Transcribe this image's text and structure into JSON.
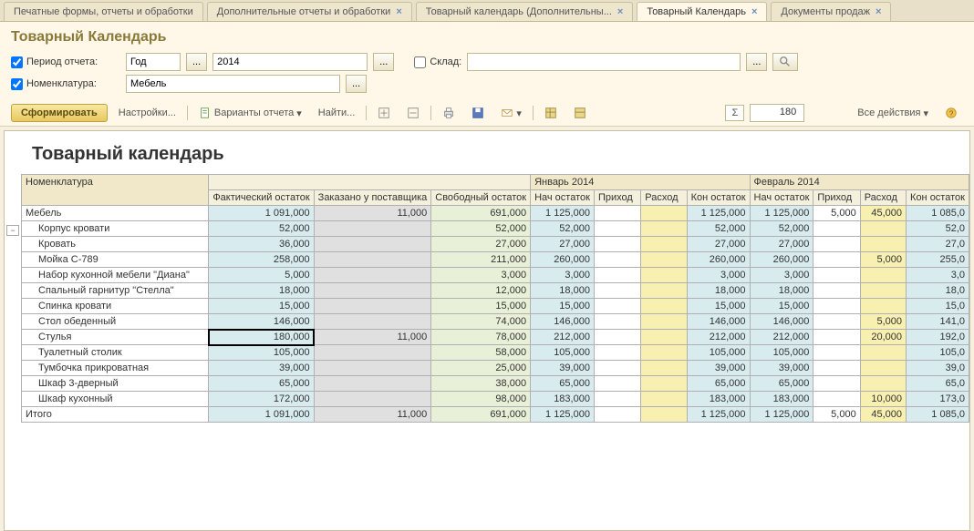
{
  "tabs": [
    {
      "label": "Печатные формы, отчеты и обработки",
      "closable": false,
      "active": false
    },
    {
      "label": "Дополнительные отчеты и обработки",
      "closable": true,
      "active": false
    },
    {
      "label": "Товарный календарь (Дополнительны...",
      "closable": true,
      "active": false
    },
    {
      "label": "Товарный Календарь",
      "closable": true,
      "active": true
    },
    {
      "label": "Документы продаж",
      "closable": true,
      "active": false
    }
  ],
  "page_title": "Товарный Календарь",
  "filters": {
    "period_label": "Период отчета:",
    "period_checked": true,
    "period_type": "Год",
    "period_value": "2014",
    "sklad_label": "Склад:",
    "sklad_checked": false,
    "sklad_value": "",
    "nomen_label": "Номенклатура:",
    "nomen_checked": true,
    "nomen_value": "Мебель"
  },
  "toolbar": {
    "form": "Сформировать",
    "settings": "Настройки...",
    "variants": "Варианты отчета",
    "find": "Найти...",
    "sum_value": "180",
    "all_actions": "Все действия"
  },
  "report": {
    "title": "Товарный календарь",
    "col_nomen": "Номенклатура",
    "month1": "Январь 2014",
    "month2": "Февраль 2014",
    "cols_main": [
      "Фактический остаток",
      "Заказано у поставщика",
      "Свободный остаток"
    ],
    "cols_month": [
      "Нач остаток",
      "Приход",
      "Расход",
      "Кон остаток"
    ],
    "group_row": {
      "name": "Мебель",
      "vals": [
        "1 091,000",
        "11,000",
        "691,000",
        "1 125,000",
        "",
        "",
        "1 125,000",
        "1 125,000",
        "5,000",
        "45,000",
        "1 085,0"
      ]
    },
    "rows": [
      {
        "name": "Корпус кровати",
        "vals": [
          "52,000",
          "",
          "52,000",
          "52,000",
          "",
          "",
          "52,000",
          "52,000",
          "",
          "",
          "52,0"
        ]
      },
      {
        "name": "Кровать",
        "vals": [
          "36,000",
          "",
          "27,000",
          "27,000",
          "",
          "",
          "27,000",
          "27,000",
          "",
          "",
          "27,0"
        ]
      },
      {
        "name": "Мойка С-789",
        "vals": [
          "258,000",
          "",
          "211,000",
          "260,000",
          "",
          "",
          "260,000",
          "260,000",
          "",
          "5,000",
          "255,0"
        ]
      },
      {
        "name": "Набор кухонной мебели \"Диана\"",
        "vals": [
          "5,000",
          "",
          "3,000",
          "3,000",
          "",
          "",
          "3,000",
          "3,000",
          "",
          "",
          "3,0"
        ]
      },
      {
        "name": "Спальный гарнитур \"Стелла\"",
        "vals": [
          "18,000",
          "",
          "12,000",
          "18,000",
          "",
          "",
          "18,000",
          "18,000",
          "",
          "",
          "18,0"
        ]
      },
      {
        "name": "Спинка кровати",
        "vals": [
          "15,000",
          "",
          "15,000",
          "15,000",
          "",
          "",
          "15,000",
          "15,000",
          "",
          "",
          "15,0"
        ]
      },
      {
        "name": "Стол обеденный",
        "vals": [
          "146,000",
          "",
          "74,000",
          "146,000",
          "",
          "",
          "146,000",
          "146,000",
          "",
          "5,000",
          "141,0"
        ]
      },
      {
        "name": "Стулья",
        "vals": [
          "180,000",
          "11,000",
          "78,000",
          "212,000",
          "",
          "",
          "212,000",
          "212,000",
          "",
          "20,000",
          "192,0"
        ],
        "selected": 0
      },
      {
        "name": "Туалетный столик",
        "vals": [
          "105,000",
          "",
          "58,000",
          "105,000",
          "",
          "",
          "105,000",
          "105,000",
          "",
          "",
          "105,0"
        ]
      },
      {
        "name": "Тумбочка прикроватная",
        "vals": [
          "39,000",
          "",
          "25,000",
          "39,000",
          "",
          "",
          "39,000",
          "39,000",
          "",
          "",
          "39,0"
        ]
      },
      {
        "name": "Шкаф 3-дверный",
        "vals": [
          "65,000",
          "",
          "38,000",
          "65,000",
          "",
          "",
          "65,000",
          "65,000",
          "",
          "",
          "65,0"
        ]
      },
      {
        "name": "Шкаф кухонный",
        "vals": [
          "172,000",
          "",
          "98,000",
          "183,000",
          "",
          "",
          "183,000",
          "183,000",
          "",
          "10,000",
          "173,0"
        ]
      }
    ],
    "total_row": {
      "name": "Итого",
      "vals": [
        "1 091,000",
        "11,000",
        "691,000",
        "1 125,000",
        "",
        "",
        "1 125,000",
        "1 125,000",
        "5,000",
        "45,000",
        "1 085,0"
      ]
    }
  }
}
